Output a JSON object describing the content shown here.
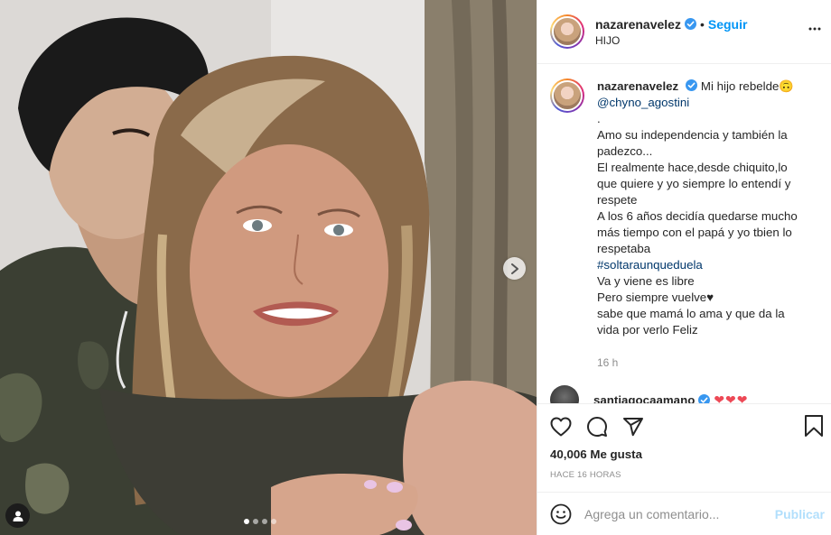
{
  "post": {
    "username": "nazarenavelez",
    "follow_label": "Seguir",
    "separator": "•",
    "location": "HIJO"
  },
  "caption": {
    "username": "nazarenavelez",
    "first_line": "Mi hijo rebelde🙃",
    "mention": "@chyno_agostini",
    "lines": [
      ".",
      "Amo su independencia y también la padezco...",
      "El realmente hace,desde chiquito,lo que quiere y yo siempre lo entendí y respete",
      "A los 6 años decidía quedarse mucho más tiempo con el papá y yo tbien lo respetaba"
    ],
    "hashtag": "#soltaraunqueduela",
    "lines_after": [
      "Va y viene es libre",
      "Pero siempre vuelve♥",
      "sabe que mamá lo ama y que da la vida por verlo Feliz"
    ],
    "time": "16 h"
  },
  "next_comment": {
    "username": "santiagocaamano",
    "hearts": "❤❤❤"
  },
  "stats": {
    "likes": "40,006 Me gusta",
    "time_ago": "Hace 16 horas"
  },
  "comment_box": {
    "placeholder": "Agrega un comentario...",
    "publish_label": "Publicar"
  },
  "carousel": {
    "count": 4,
    "active_index": 0
  },
  "colors": {
    "accent": "#0095f6",
    "link": "#00376b",
    "muted": "#8e8e8e",
    "publish_disabled": "#b2dffc"
  }
}
